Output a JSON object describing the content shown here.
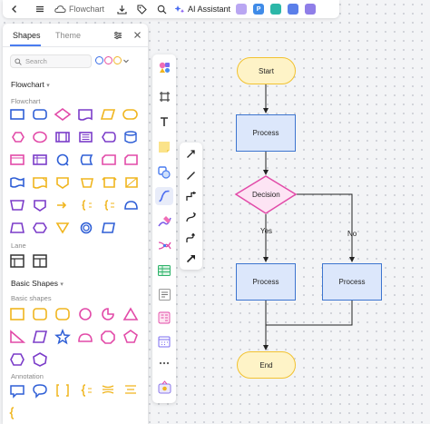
{
  "app": {
    "document_title": "Flowchart",
    "ai_assistant_label": "AI Assistant"
  },
  "panel": {
    "tabs": [
      {
        "label": "Shapes"
      },
      {
        "label": "Theme"
      }
    ],
    "search_placeholder": "Search",
    "theme_dots": [
      "#3a6ee8",
      "#e84f9c",
      "#f1b82d"
    ],
    "sections": {
      "flowchart": "Flowchart",
      "flowchart_sub": "Flowchart",
      "lane": "Lane",
      "basic_shapes": "Basic Shapes",
      "basic_shapes_sub": "Basic shapes",
      "annotation": "Annotation"
    }
  },
  "colors": {
    "shape_blue": "#2f5fd6",
    "shape_pink": "#e24aa8",
    "shape_purple": "#7b3cc9",
    "shape_yellow": "#f0b51e",
    "terminal_fill": "#fef3c7",
    "terminal_stroke": "#f2c230",
    "process_fill": "#dce7fb",
    "process_stroke": "#3d75cf",
    "decision_fill": "#fde4f4",
    "decision_stroke": "#e24aa8"
  },
  "flowchart": {
    "start": "Start",
    "process1": "Process",
    "decision": "Decision",
    "yes": "Yes",
    "no": "No",
    "process2": "Process",
    "process3": "Process",
    "end": "End"
  }
}
